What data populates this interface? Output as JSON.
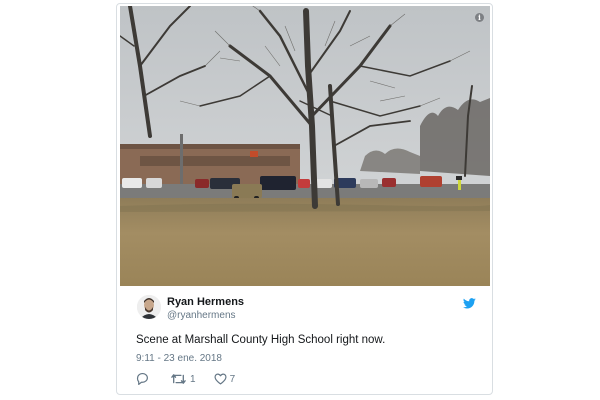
{
  "tweet": {
    "author_name": "Ryan Hermens",
    "author_handle": "@ryanhermens",
    "text": "Scene at Marshall County High School right now.",
    "timestamp": "9:11 - 23 ene. 2018",
    "retweet_count": "1",
    "like_count": "7"
  },
  "icons": {
    "info": "info-icon",
    "bird": "twitter-bird-icon",
    "reply": "reply-icon",
    "retweet": "retweet-icon",
    "like": "heart-icon"
  },
  "colors": {
    "brand": "#1da1f2",
    "text": "#14171a",
    "muted": "#657786"
  },
  "labels": {
    "info_glyph": "i"
  }
}
